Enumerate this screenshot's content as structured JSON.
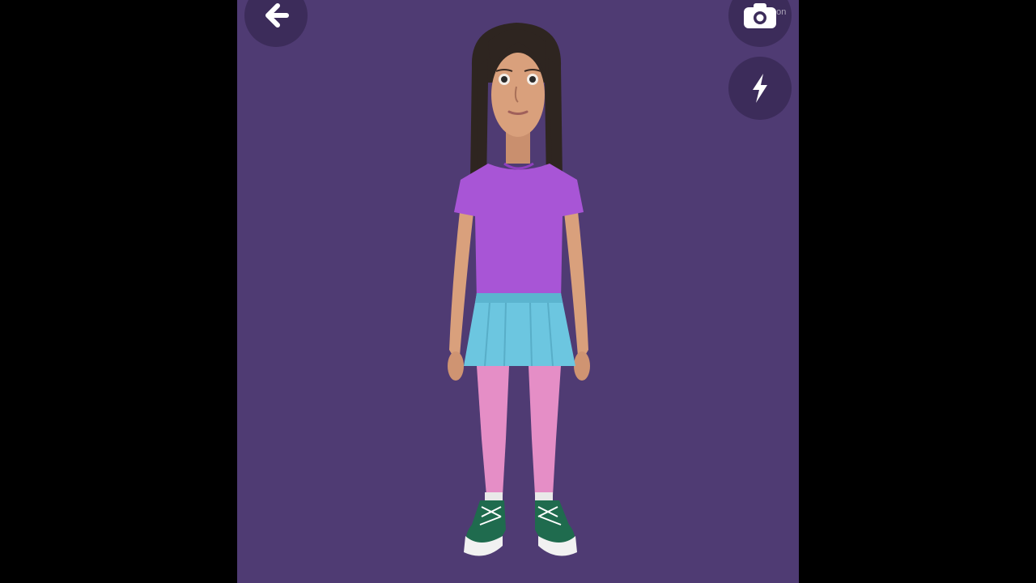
{
  "app": {
    "background_color": "#4f3b73",
    "letterbox_color": "#000000",
    "button_color": "#3c2c5a"
  },
  "toolbar": {
    "back_icon": "arrow-left-icon",
    "camera_icon": "camera-icon",
    "flash_icon": "lightning-bolt-icon",
    "watermark": "gon"
  },
  "avatar": {
    "description_icon": "3d-avatar-figure",
    "hair_color": "#2e2520",
    "skin_color": "#d9a07c",
    "shirt_color": "#a855d6",
    "skirt_color": "#6cc6e0",
    "leggings_color": "#e58ec6",
    "shoe_color": "#1f6b4e"
  }
}
